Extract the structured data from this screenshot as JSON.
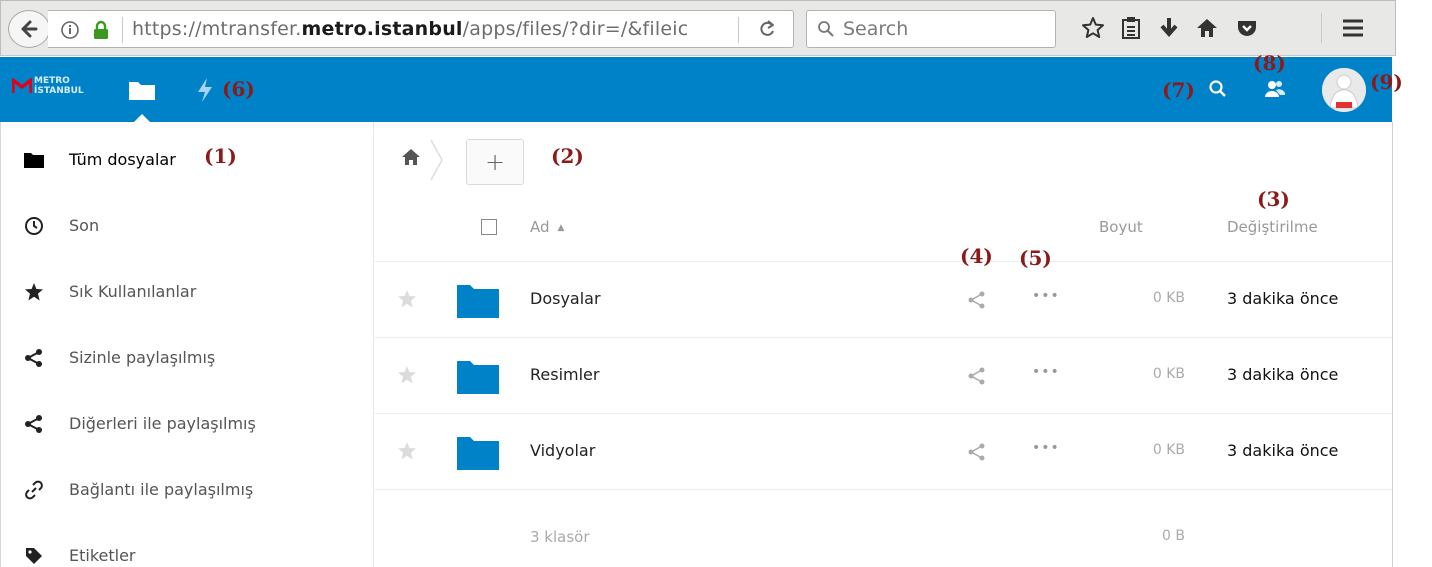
{
  "browser": {
    "url_prefix": "https://mtransfer.",
    "url_domain": "metro.istanbul",
    "url_suffix": "/apps/files/?dir=/&fileic",
    "search_placeholder": "Search",
    "toolbar_icons": [
      "star-icon",
      "reading-list-icon",
      "download-icon",
      "home-icon",
      "pocket-icon",
      "menu-icon"
    ]
  },
  "header": {
    "logo_line1": "METRO",
    "logo_line2": "İSTANBUL",
    "brand_color": "#0082c9"
  },
  "sidebar": {
    "items": [
      {
        "label": "Tüm dosyalar",
        "icon": "folder-icon"
      },
      {
        "label": "Son",
        "icon": "clock-icon"
      },
      {
        "label": "Sık Kullanılanlar",
        "icon": "star-icon"
      },
      {
        "label": "Sizinle paylaşılmış",
        "icon": "share-icon"
      },
      {
        "label": "Diğerleri ile paylaşılmış",
        "icon": "share-icon"
      },
      {
        "label": "Bağlantı ile paylaşılmış",
        "icon": "link-icon"
      },
      {
        "label": "Etiketler",
        "icon": "tag-icon"
      }
    ]
  },
  "main": {
    "new_button": "+",
    "columns": {
      "name": "Ad",
      "size": "Boyut",
      "modified": "Değiştirilme"
    },
    "rows": [
      {
        "name": "Dosyalar",
        "size": "0 KB",
        "modified": "3 dakika önce"
      },
      {
        "name": "Resimler",
        "size": "0 KB",
        "modified": "3 dakika önce"
      },
      {
        "name": "Vidyolar",
        "size": "0 KB",
        "modified": "3 dakika önce"
      }
    ],
    "summary_count": "3 klasör",
    "summary_size": "0 B"
  },
  "annotations": {
    "a1": "(1)",
    "a2": "(2)",
    "a3": "(3)",
    "a4": "(4)",
    "a5": "(5)",
    "a6": "(6)",
    "a7": "(7)",
    "a8": "(8)",
    "a9": "(9)"
  }
}
